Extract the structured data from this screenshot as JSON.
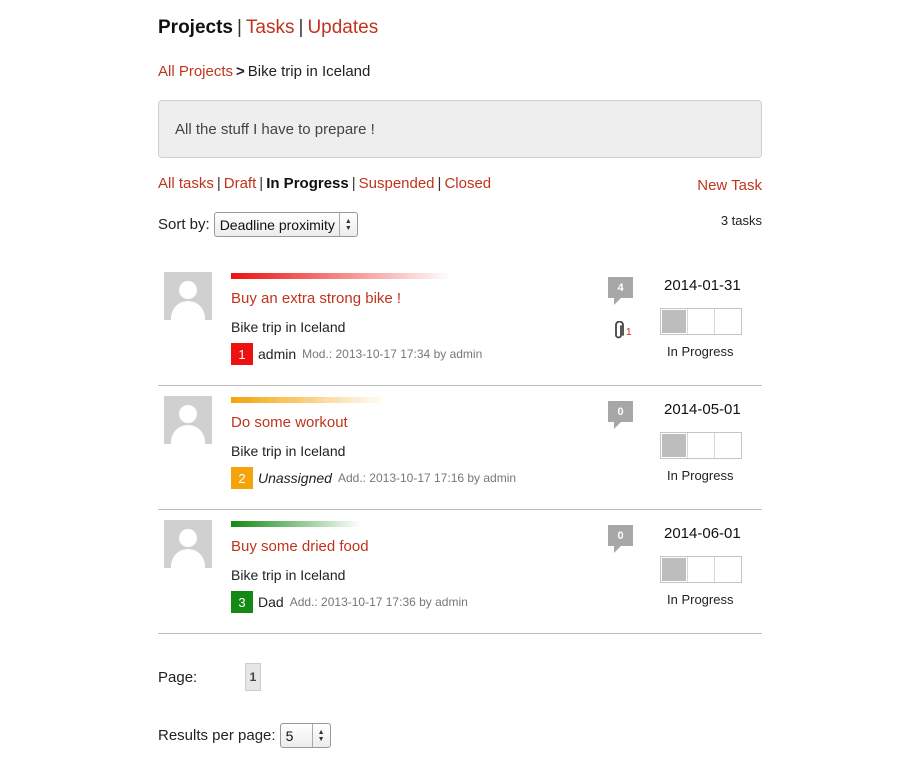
{
  "nav": {
    "projects": "Projects",
    "tasks": "Tasks",
    "updates": "Updates",
    "sep": "|"
  },
  "breadcrumb": {
    "all_projects": "All Projects",
    "gt": ">",
    "current": "Bike trip in Iceland"
  },
  "description": "All the stuff I have to prepare !",
  "filters": {
    "all": "All tasks",
    "draft": "Draft",
    "in_progress": "In Progress",
    "suspended": "Suspended",
    "closed": "Closed",
    "sep": "|"
  },
  "new_task": "New Task",
  "sort": {
    "label": "Sort by:",
    "value": "Deadline proximity"
  },
  "task_count": "3 tasks",
  "tasks": [
    {
      "title": "Buy an extra strong bike !",
      "project": "Bike trip in Iceland",
      "priority": "1",
      "priority_color": "#ee1111",
      "assignee": "admin",
      "info": "Mod.: 2013-10-17 17:34 by admin",
      "comments": "4",
      "attachments": "1",
      "deadline": "2014-01-31",
      "progress": 0.33,
      "status": "In Progress"
    },
    {
      "title": "Do some workout",
      "project": "Bike trip in Iceland",
      "priority": "2",
      "priority_color": "#f5a30a",
      "assignee": "Unassigned",
      "info": "Add.: 2013-10-17 17:16 by admin",
      "comments": "0",
      "deadline": "2014-05-01",
      "progress": 0.33,
      "status": "In Progress"
    },
    {
      "title": "Buy some dried food",
      "project": "Bike trip in Iceland",
      "priority": "3",
      "priority_color": "#138a13",
      "assignee": "Dad",
      "info": "Add.: 2013-10-17 17:36 by admin",
      "comments": "0",
      "deadline": "2014-06-01",
      "progress": 0.33,
      "status": "In Progress"
    }
  ],
  "pager": {
    "label": "Page:",
    "current": "1"
  },
  "results_per_page": {
    "label": "Results per page:",
    "value": "5"
  }
}
